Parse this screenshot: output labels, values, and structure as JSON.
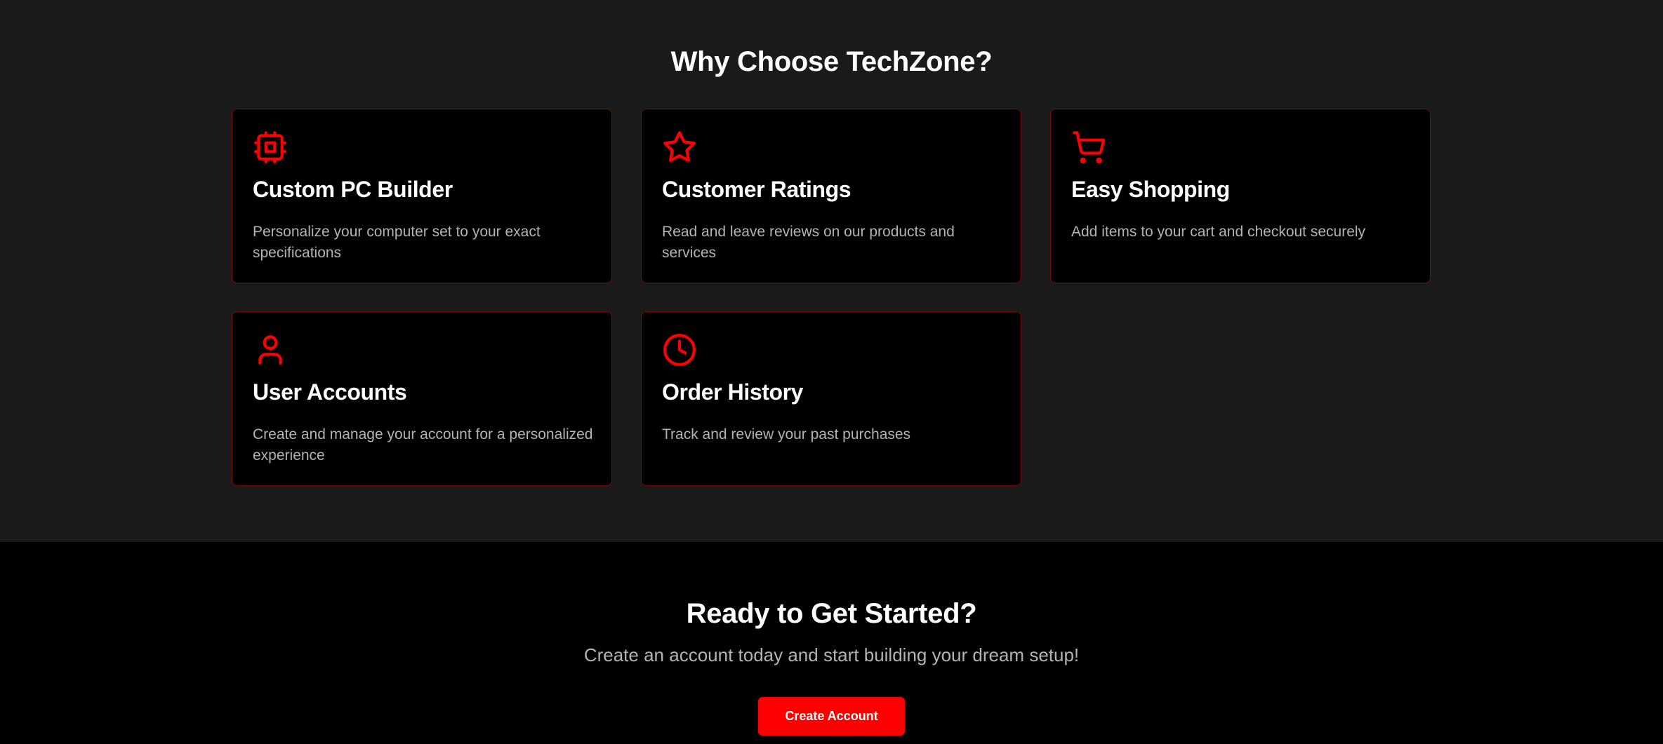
{
  "features": {
    "title": "Why Choose TechZone?",
    "items": [
      {
        "icon": "cpu-icon",
        "title": "Custom PC Builder",
        "description": "Personalize your computer set to your exact specifications"
      },
      {
        "icon": "star-icon",
        "title": "Customer Ratings",
        "description": "Read and leave reviews on our products and services"
      },
      {
        "icon": "shopping-cart-icon",
        "title": "Easy Shopping",
        "description": "Add items to your cart and checkout securely"
      },
      {
        "icon": "user-icon",
        "title": "User Accounts",
        "description": "Create and manage your account for a personalized experience"
      },
      {
        "icon": "clock-icon",
        "title": "Order History",
        "description": "Track and review your past purchases"
      }
    ]
  },
  "cta": {
    "title": "Ready to Get Started?",
    "subtitle": "Create an account today and start building your dream setup!",
    "button_label": "Create Account"
  },
  "colors": {
    "accent": "#ff0000",
    "card_border": "#7a0a0a",
    "section_bg": "#1a1a1a",
    "card_bg": "#000000",
    "muted_text": "#b3b3b3"
  }
}
